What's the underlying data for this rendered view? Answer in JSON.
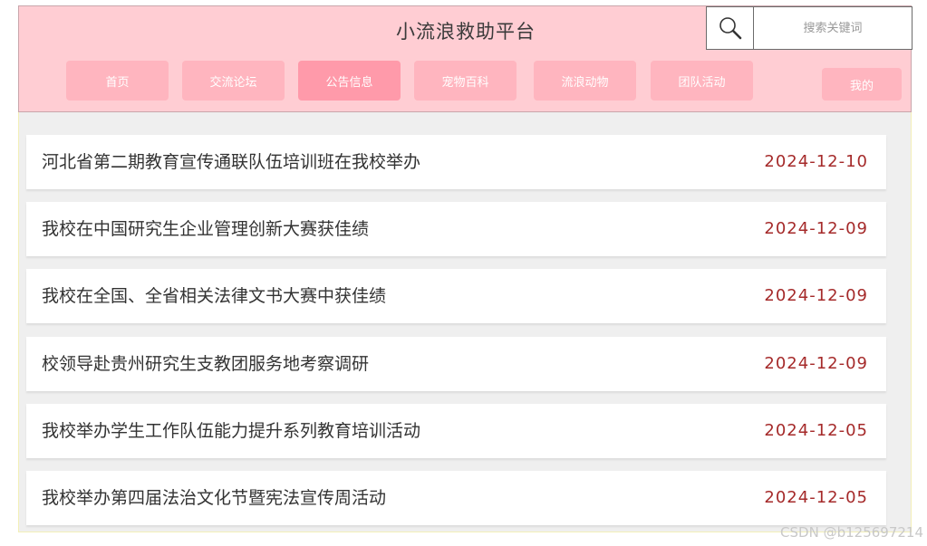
{
  "header": {
    "title": "小流浪救助平台",
    "search": {
      "placeholder": "搜索关键词",
      "icon": "search-icon"
    },
    "nav": [
      {
        "label": "首页"
      },
      {
        "label": "交流论坛"
      },
      {
        "label": "公告信息",
        "active": true
      },
      {
        "label": "宠物百科"
      },
      {
        "label": "流浪动物"
      },
      {
        "label": "团队活动"
      }
    ],
    "mine_label": "我的"
  },
  "news": [
    {
      "title": "河北省第二期教育宣传通联队伍培训班在我校举办",
      "date": "2024-12-10"
    },
    {
      "title": "我校在中国研究生企业管理创新大赛获佳绩",
      "date": "2024-12-09"
    },
    {
      "title": "我校在全国、全省相关法律文书大赛中获佳绩",
      "date": "2024-12-09"
    },
    {
      "title": "校领导赴贵州研究生支教团服务地考察调研",
      "date": "2024-12-09"
    },
    {
      "title": "我校举办学生工作队伍能力提升系列教育培训活动",
      "date": "2024-12-05"
    },
    {
      "title": "我校举办第四届法治文化节暨宪法宣传周活动",
      "date": "2024-12-05"
    }
  ],
  "watermark": "CSDN @b125697214",
  "colors": {
    "header_bg": "#ffcdd3",
    "nav_button": "#ffb5bf",
    "nav_active": "#ff9aaa",
    "date_text": "#a52a2a",
    "content_bg": "#efefef"
  }
}
